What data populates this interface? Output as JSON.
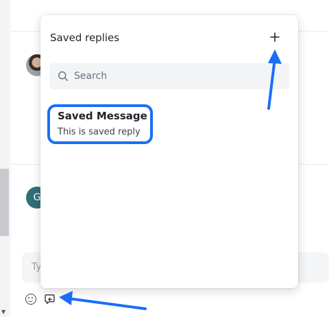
{
  "popover": {
    "title": "Saved replies",
    "add_icon": "plus-icon",
    "search": {
      "placeholder": "Search",
      "value": "",
      "icon": "search-icon"
    },
    "replies": [
      {
        "title": "Saved Message",
        "text": "This is saved reply"
      }
    ]
  },
  "background": {
    "avatar_letter": "G",
    "compose_placeholder": "Ty",
    "toolbar_icons": [
      "emoji-icon",
      "saved-replies-icon"
    ]
  },
  "annotation": {
    "accent_color": "#1a6ff5"
  },
  "colors": {
    "popover_bg": "#ffffff",
    "search_bg": "#f3f4f6",
    "text": "#1f2328"
  }
}
